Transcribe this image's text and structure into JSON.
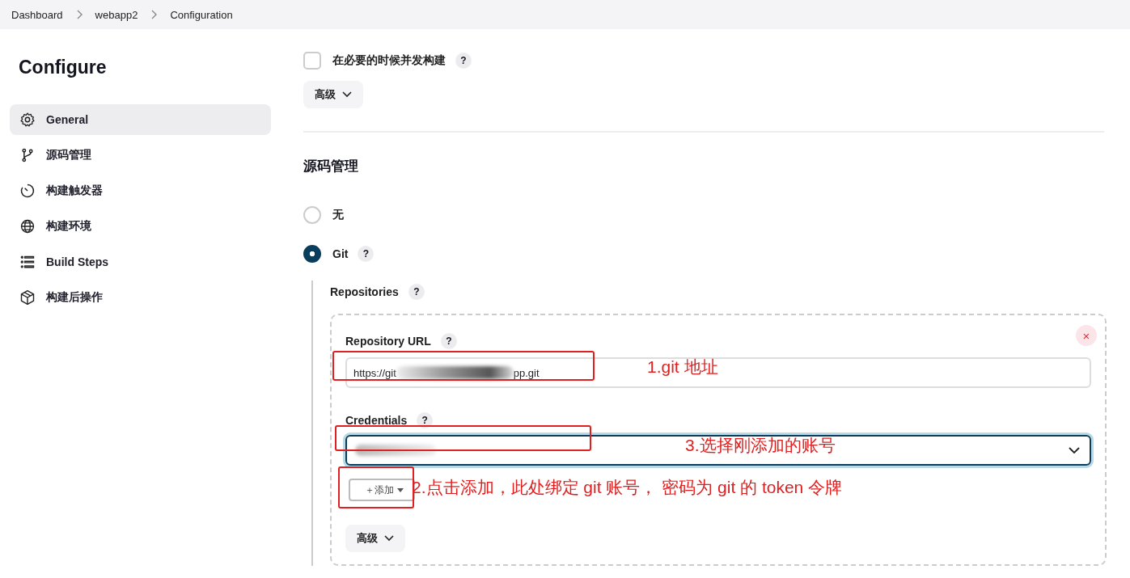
{
  "breadcrumbs": [
    "Dashboard",
    "webapp2",
    "Configuration"
  ],
  "sidebar": {
    "title": "Configure",
    "items": [
      {
        "label": "General",
        "selected": true
      },
      {
        "label": "源码管理",
        "selected": false
      },
      {
        "label": "构建触发器",
        "selected": false
      },
      {
        "label": "构建环境",
        "selected": false
      },
      {
        "label": "Build Steps",
        "selected": false
      },
      {
        "label": "构建后操作",
        "selected": false
      }
    ]
  },
  "general": {
    "concurrent": {
      "label": "在必要的时候并发构建",
      "checked": false,
      "help": "?"
    },
    "advanced": "高级"
  },
  "scm": {
    "heading": "源码管理",
    "options": [
      {
        "label": "无",
        "selected": false
      },
      {
        "label": "Git",
        "selected": true,
        "help": "?"
      }
    ],
    "repositories": {
      "label": "Repositories",
      "help": "?"
    },
    "repo": {
      "url_label": "Repository URL",
      "url_help": "?",
      "url_start": "https://git",
      "url_end": "pp.git",
      "credentials_label": "Credentials",
      "credentials_help": "?",
      "add_button": "＋添加",
      "advanced": "高级",
      "close": "×"
    }
  },
  "annotations": [
    "1.git 地址",
    "3.选择刚添加的账号",
    "2.点击添加，此处绑定 git 账号， 密码为 git 的 token 令牌"
  ]
}
